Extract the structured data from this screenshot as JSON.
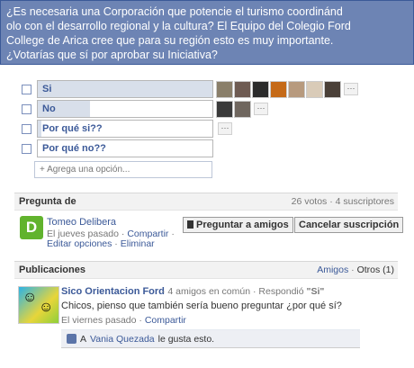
{
  "question": {
    "line1": "¿Es necesaria una Corporación que potencie el turismo coordinánd",
    "line2": "olo con el desarrollo regional y la cultura? El Equipo del Colegio Ford",
    "line3": "College de Arica cree que para su región esto es muy importante.",
    "line4": "¿Votarías que sí por aprobar su Iniciativa?"
  },
  "options": [
    {
      "label": "Si",
      "share": 1.0,
      "voters": 7
    },
    {
      "label": "No",
      "share": 0.3,
      "voters": 2
    },
    {
      "label": "Por qué si??",
      "share": 0.02,
      "voters": 0
    },
    {
      "label": "Por qué no??",
      "share": 0.0,
      "voters": 0
    }
  ],
  "more_label": "···",
  "add_option_placeholder": "+ Agrega una opción...",
  "ask_section": {
    "title": "Pregunta de",
    "stats": "26 votos · 4 suscriptores",
    "asker_logo": "D",
    "asker_name": "Tomeo Delibera",
    "when": "El jueves pasado",
    "share": "Compartir",
    "edit": "Editar opciones",
    "remove": "Eliminar",
    "ask_friends_label": "Preguntar a amigos",
    "unsubscribe_label": "Cancelar suscripción"
  },
  "publications": {
    "title": "Publicaciones",
    "filter_friends": "Amigos",
    "filter_others": "Otros (1)",
    "post": {
      "author": "Sico Orientacion Ford",
      "mutual": "4 amigos en común",
      "answered_prefix": "Respondió",
      "answer": "\"Si\"",
      "text": "Chicos, pienso que también sería bueno preguntar ¿por qué sí?",
      "when": "El viernes pasado",
      "share": "Compartir",
      "like_prefix": "A",
      "like_name": "Vania Quezada",
      "like_suffix": "le gusta esto."
    }
  },
  "colors": {
    "header_bg": "#6d84b4",
    "link": "#3b5998",
    "bar_fill": "#d8dfea",
    "logo_green": "#61b32d"
  },
  "icons": [
    "checkbox-icon",
    "thumbs-up-icon",
    "question-icon",
    "more-dots-icon"
  ]
}
